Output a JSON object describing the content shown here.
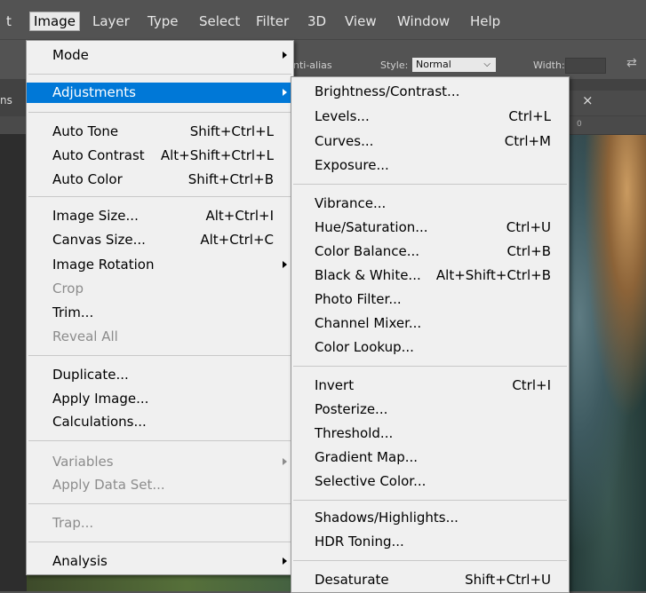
{
  "menubar": {
    "items": [
      {
        "label": "t"
      },
      {
        "label": "Image"
      },
      {
        "label": "Layer"
      },
      {
        "label": "Type"
      },
      {
        "label": "Select"
      },
      {
        "label": "Filter"
      },
      {
        "label": "3D"
      },
      {
        "label": "View"
      },
      {
        "label": "Window"
      },
      {
        "label": "Help"
      }
    ]
  },
  "options_bar": {
    "antialias_label": "nti-alias",
    "style_label": "Style:",
    "style_value": "Normal",
    "width_label": "Width:"
  },
  "doc_tab": {
    "prefix": "ns",
    "close_glyph": "×"
  },
  "ruler": {
    "tick_label": "0"
  },
  "image_menu": {
    "mode": "Mode",
    "adjustments": "Adjustments",
    "auto_tone": "Auto Tone",
    "auto_tone_shortcut": "Shift+Ctrl+L",
    "auto_contrast": "Auto Contrast",
    "auto_contrast_shortcut": "Alt+Shift+Ctrl+L",
    "auto_color": "Auto Color",
    "auto_color_shortcut": "Shift+Ctrl+B",
    "image_size": "Image Size...",
    "image_size_shortcut": "Alt+Ctrl+I",
    "canvas_size": "Canvas Size...",
    "canvas_size_shortcut": "Alt+Ctrl+C",
    "image_rotation": "Image Rotation",
    "crop": "Crop",
    "trim": "Trim...",
    "reveal_all": "Reveal All",
    "duplicate": "Duplicate...",
    "apply_image": "Apply Image...",
    "calculations": "Calculations...",
    "variables": "Variables",
    "apply_data_set": "Apply Data Set...",
    "trap": "Trap...",
    "analysis": "Analysis"
  },
  "adjustments_menu": {
    "brightness_contrast": "Brightness/Contrast...",
    "levels": "Levels...",
    "levels_shortcut": "Ctrl+L",
    "curves": "Curves...",
    "curves_shortcut": "Ctrl+M",
    "exposure": "Exposure...",
    "vibrance": "Vibrance...",
    "hue_saturation": "Hue/Saturation...",
    "hue_saturation_shortcut": "Ctrl+U",
    "color_balance": "Color Balance...",
    "color_balance_shortcut": "Ctrl+B",
    "black_white": "Black & White...",
    "black_white_shortcut": "Alt+Shift+Ctrl+B",
    "photo_filter": "Photo Filter...",
    "channel_mixer": "Channel Mixer...",
    "color_lookup": "Color Lookup...",
    "invert": "Invert",
    "invert_shortcut": "Ctrl+I",
    "posterize": "Posterize...",
    "threshold": "Threshold...",
    "gradient_map": "Gradient Map...",
    "selective_color": "Selective Color...",
    "shadows_highlights": "Shadows/Highlights...",
    "hdr_toning": "HDR Toning...",
    "desaturate": "Desaturate",
    "desaturate_shortcut": "Shift+Ctrl+U"
  },
  "colors": {
    "highlight": "#0078d7",
    "menu_bg": "#f0f0f0",
    "app_bg": "#535353",
    "disabled_text": "#8c8c8c"
  }
}
